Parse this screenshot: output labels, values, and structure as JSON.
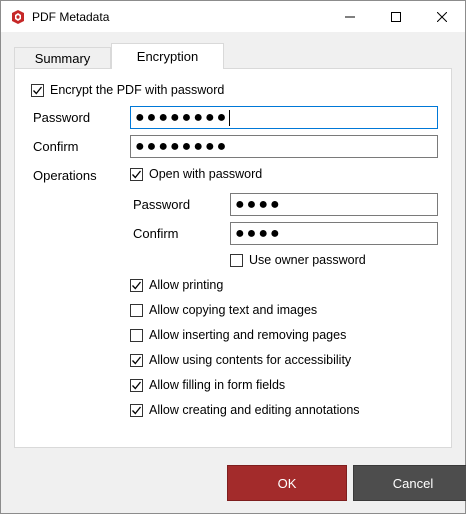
{
  "window": {
    "title": "PDF Metadata"
  },
  "tabs": [
    {
      "label": "Summary",
      "active": false
    },
    {
      "label": "Encryption",
      "active": true
    }
  ],
  "encryption": {
    "encrypt_label": "Encrypt the PDF with password",
    "encrypt_checked": true,
    "password_label": "Password",
    "password_value": "●●●●●●●●",
    "confirm_label": "Confirm",
    "confirm_value": "●●●●●●●●",
    "operations_label": "Operations",
    "open_with_password_label": "Open with password",
    "open_with_password_checked": true,
    "open_password_label": "Password",
    "open_password_value": "●●●●",
    "open_confirm_label": "Confirm",
    "open_confirm_value": "●●●●",
    "use_owner_label": "Use owner password",
    "use_owner_checked": false,
    "permissions": [
      {
        "label": "Allow printing",
        "checked": true
      },
      {
        "label": "Allow copying text and images",
        "checked": false
      },
      {
        "label": "Allow inserting and removing pages",
        "checked": false
      },
      {
        "label": "Allow using contents for accessibility",
        "checked": true
      },
      {
        "label": "Allow filling in form fields",
        "checked": true
      },
      {
        "label": "Allow creating and editing annotations",
        "checked": true
      }
    ]
  },
  "buttons": {
    "ok_label": "OK",
    "cancel_label": "Cancel"
  },
  "colors": {
    "ok": "#a32b2b",
    "cancel": "#4d4d4d",
    "focus": "#0078d7"
  }
}
